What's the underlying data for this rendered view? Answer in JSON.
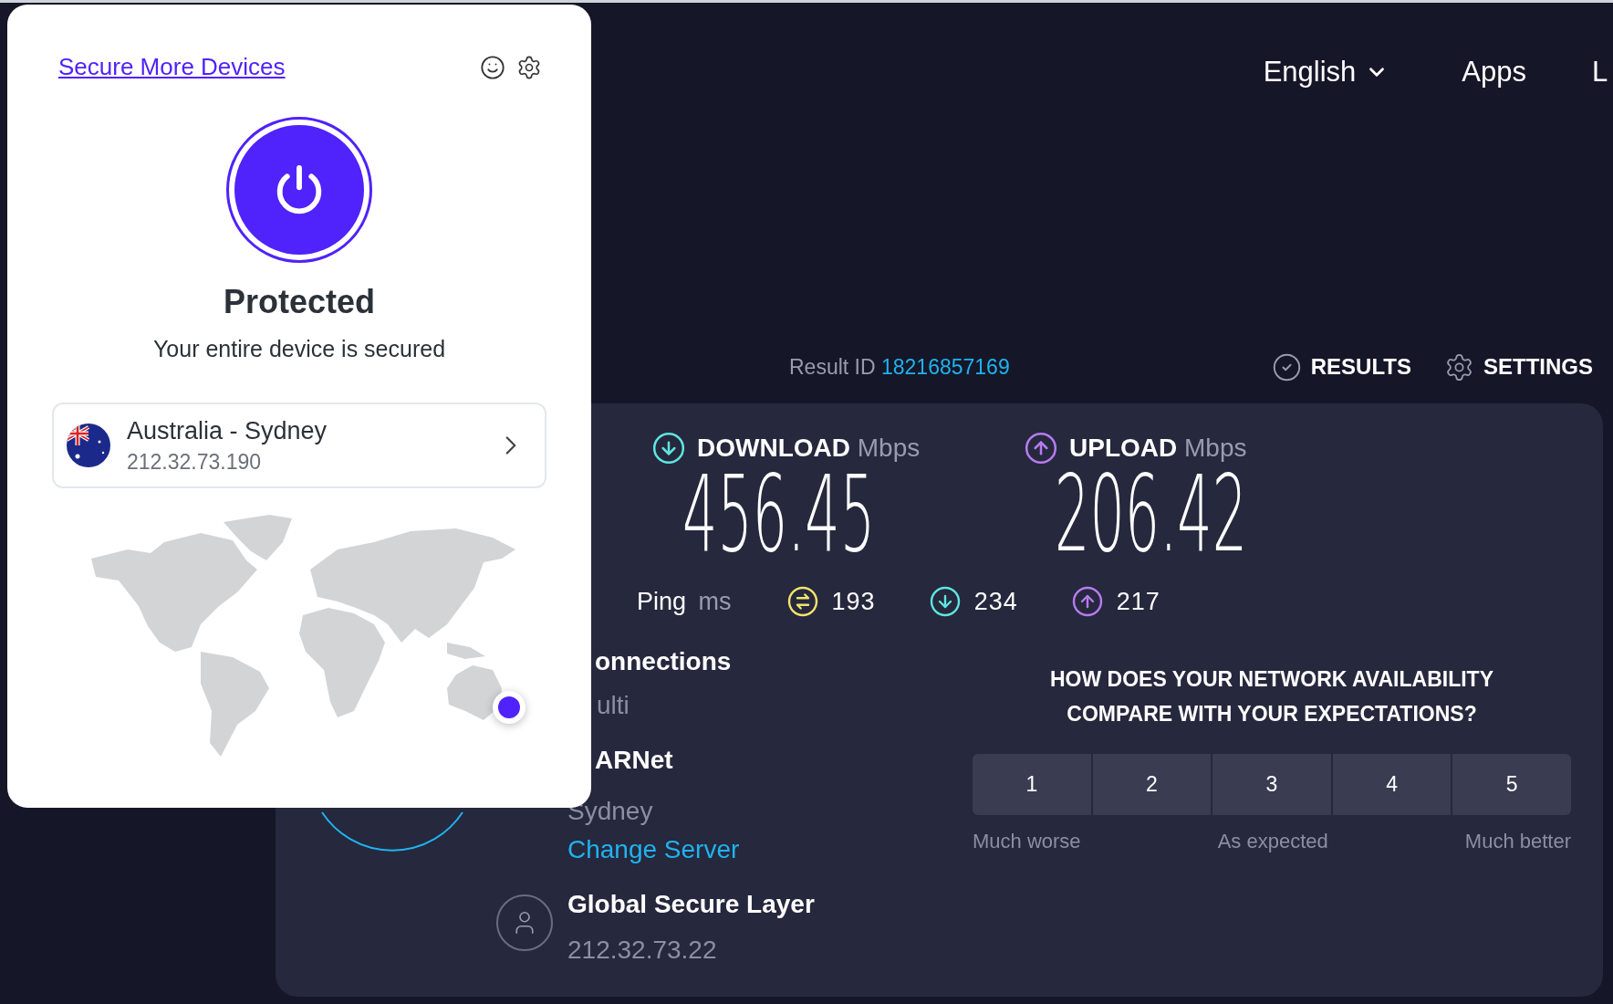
{
  "popup": {
    "link": "Secure More Devices",
    "power": {
      "on": true
    },
    "status": "Protected",
    "subtitle": "Your entire device is secured",
    "location": {
      "name": "Australia - Sydney",
      "ip": "212.32.73.190"
    }
  },
  "nav": [
    {
      "label": "English",
      "kind": "dropdown"
    },
    {
      "label": "Apps",
      "kind": "link"
    },
    {
      "label": "L",
      "kind": "link"
    }
  ],
  "result": {
    "label": "Result ID",
    "id": "18216857169"
  },
  "actions": [
    {
      "label": "RESULTS",
      "kind": "results"
    },
    {
      "label": "SETTINGS",
      "kind": "settings"
    }
  ],
  "speeds": [
    {
      "kind": "download",
      "label": "DOWNLOAD",
      "unit": "Mbps",
      "value": "456.45"
    },
    {
      "kind": "upload",
      "label": "UPLOAD",
      "unit": "Mbps",
      "value": "206.42"
    }
  ],
  "ping": {
    "label": "Ping",
    "unit": "ms",
    "readings": [
      {
        "kind": "idle",
        "value": "193"
      },
      {
        "kind": "download",
        "value": "234"
      },
      {
        "kind": "upload",
        "value": "217"
      }
    ]
  },
  "connections": {
    "title": "onnections",
    "value": "ulti"
  },
  "server": {
    "name": "ARNet",
    "location": "Sydney",
    "link": "Change Server"
  },
  "provider": {
    "name": "Global Secure Layer",
    "ip": "212.32.73.22"
  },
  "survey": {
    "question": "HOW DOES YOUR NETWORK AVAILABILITY COMPARE WITH YOUR EXPECTATIONS?",
    "options": [
      {
        "label": "1",
        "selected": false
      },
      {
        "label": "2",
        "selected": false
      },
      {
        "label": "3",
        "selected": false
      },
      {
        "label": "4",
        "selected": false
      },
      {
        "label": "5",
        "selected": false
      }
    ],
    "scale": [
      "Much worse",
      "As expected",
      "Much better"
    ]
  }
}
